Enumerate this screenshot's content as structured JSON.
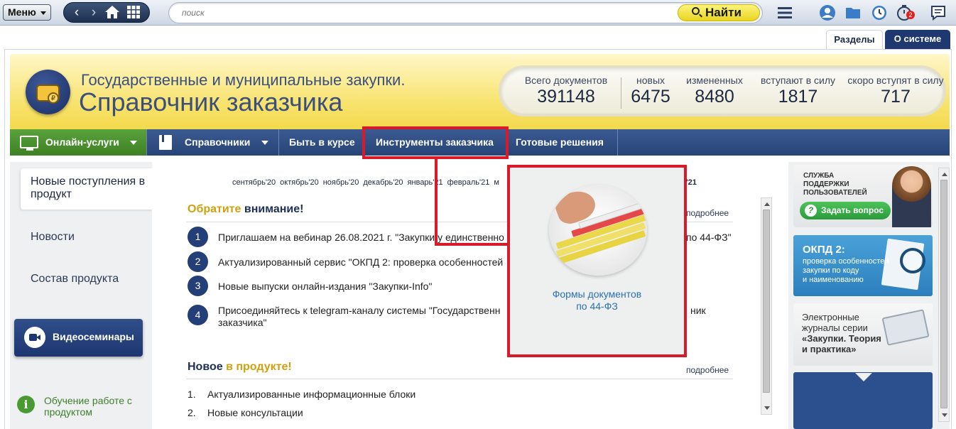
{
  "toolbar": {
    "menu_label": "Меню",
    "search_placeholder": "поиск",
    "find_label": "Найти",
    "notifications_count": "2"
  },
  "tabs": [
    "Разделы",
    "О системе"
  ],
  "header": {
    "line1": "Государственные и муниципальные закупки.",
    "line2": "Справочник заказчика",
    "stats": [
      {
        "label": "Всего документов",
        "value": "391148"
      },
      {
        "label": "новых",
        "value": "6475"
      },
      {
        "label": "измененных",
        "value": "8480"
      },
      {
        "label": "вступают в силу",
        "value": "1817"
      },
      {
        "label": "скоро вступят в силу",
        "value": "717"
      }
    ]
  },
  "nav": {
    "online": "Онлайн-услуги",
    "spravochniki": "Справочники",
    "kurs": "Быть в курсе",
    "instrumenty": "Инструменты заказчика",
    "gotovye": "Готовые решения"
  },
  "sidebar": {
    "active": "Новые поступления в продукт",
    "items": [
      "Новости",
      "Состав продукта"
    ],
    "video_button": "Видеосеминары",
    "training": "Обучение работе с продуктом"
  },
  "main": {
    "months": [
      "сентябрь'20",
      "октябрь'20",
      "ноябрь'20",
      "декабрь'20",
      "январь'21",
      "февраль'21",
      "м"
    ],
    "month_tail": "'21",
    "attention_title_a": "Обратите",
    "attention_title_b": " внимание!",
    "more_label": "подробнее",
    "attention_items": [
      {
        "n": "1",
        "text": "Приглашаем на вебинар 26.08.2021 г. \"Закупки у единственно",
        "tail": "по 44-ФЗ\""
      },
      {
        "n": "2",
        "text": "Актуализированный сервис \"ОКПД 2: проверка особенностей",
        "tail": ""
      },
      {
        "n": "3",
        "text": "Новые выпуски онлайн-издания \"Закупки-Info\"",
        "tail": ""
      },
      {
        "n": "4",
        "text": "Присоединяйтесь к telegram-каналу системы \"Государственн",
        "tail": "ник",
        "line2": "заказчика\""
      }
    ],
    "new_title_a": "Новое",
    "new_title_b": " в продукте!",
    "new_items": [
      {
        "n": "1.",
        "text": "Актуализированные информационные блоки"
      },
      {
        "n": "2.",
        "text": "Новые консультации"
      }
    ]
  },
  "popup": {
    "caption_line1": "Формы документов",
    "caption_line2": "по 44-ФЗ"
  },
  "right": {
    "support_text": "СЛУЖБА ПОДДЕРЖКИ ПОЛЬЗОВАТЕЛЕЙ",
    "support_line1": "СЛУЖБА",
    "support_line2": "ПОДДЕРЖКИ",
    "support_line3": "ПОЛЬЗОВАТЕЛЕЙ",
    "ask_button": "Задать вопрос",
    "okpd_title": "ОКПД 2:",
    "okpd_line1": "проверка особенностей",
    "okpd_line2": "закупки по коду",
    "okpd_line3": "и наименованию",
    "journals_line1": "Электронные",
    "journals_line2": "журналы серии",
    "journals_line3": "«Закупки. Теория",
    "journals_line4": "и практика»"
  },
  "colors": {
    "accent_red": "#d81a2a",
    "nav_blue": "#264477",
    "online_green": "#3e8024",
    "title_gold": "#d0a10c"
  }
}
